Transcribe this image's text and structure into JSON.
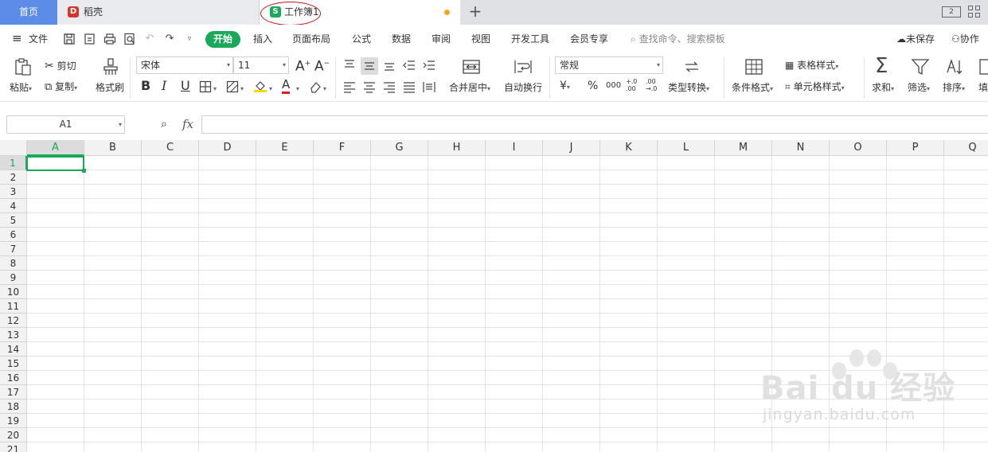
{
  "tabs": {
    "home": "首页",
    "doc": "稻壳",
    "book": "工作簿1",
    "add": "+",
    "layout_toggle": "2"
  },
  "menu": {
    "file": "文件",
    "items": [
      "开始",
      "插入",
      "页面布局",
      "公式",
      "数据",
      "审阅",
      "视图",
      "开发工具",
      "会员专享"
    ],
    "search_placeholder": "查找命令、搜索模板",
    "unsaved": "未保存",
    "collab": "协作"
  },
  "ribbon": {
    "paste": "粘贴",
    "cut": "剪切",
    "copy": "复制",
    "format_painter": "格式刷",
    "font_name": "宋体",
    "font_size": "11",
    "bold": "B",
    "italic": "I",
    "underline": "U",
    "font_color_glyph": "A",
    "merge_center": "合并居中",
    "wrap_text": "自动换行",
    "number_format": "常规",
    "currency": "¥",
    "percent": "%",
    "thousands": "000",
    "dec_add": "+.0 .00",
    "dec_remove": ".00 →.0",
    "type_convert": "类型转换",
    "cond_format": "条件格式",
    "table_style": "表格样式",
    "cell_style": "单元格样式",
    "sum": "求和",
    "filter": "筛选",
    "sort": "排序",
    "fill": "填"
  },
  "formula_bar": {
    "name_box": "A1",
    "fx": "fx",
    "value": ""
  },
  "sheet": {
    "columns": [
      "A",
      "B",
      "C",
      "D",
      "E",
      "F",
      "G",
      "H",
      "I",
      "J",
      "K",
      "L",
      "M",
      "N",
      "O",
      "P",
      "Q"
    ],
    "rows": [
      "1",
      "2",
      "3",
      "4",
      "5",
      "6",
      "7",
      "8",
      "9",
      "10",
      "11",
      "12",
      "13",
      "14",
      "15",
      "16",
      "17",
      "18",
      "19",
      "20",
      "21"
    ],
    "active_cell": "A1"
  },
  "watermark": {
    "brand": "Bai du 经验",
    "url": "jingyan.baidu.com"
  },
  "colors": {
    "accent_green": "#1aa85a",
    "home_tab_blue": "#5b8de8",
    "annotation_red": "#c4161c"
  }
}
